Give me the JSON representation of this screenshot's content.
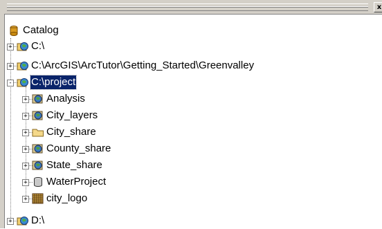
{
  "window": {
    "close_glyph": "x"
  },
  "tree": {
    "root": {
      "label": "Catalog",
      "icon": "catalog-icon"
    },
    "items": [
      {
        "label": "C:\\",
        "icon": "folder-connection-icon",
        "expander": "+"
      },
      {
        "label": "C:\\ArcGIS\\ArcTutor\\Getting_Started\\Greenvalley",
        "icon": "folder-connection-icon",
        "expander": "+"
      },
      {
        "label": "C:\\project",
        "icon": "folder-connection-icon",
        "expander": "-",
        "selected": true,
        "children": [
          {
            "label": "Analysis",
            "icon": "layer-package-icon",
            "expander": "+"
          },
          {
            "label": "City_layers",
            "icon": "layer-package-icon",
            "expander": "+"
          },
          {
            "label": "City_share",
            "icon": "folder-icon",
            "expander": "+"
          },
          {
            "label": "County_share",
            "icon": "layer-package-icon",
            "expander": "+"
          },
          {
            "label": "State_share",
            "icon": "layer-package-icon",
            "expander": "+"
          },
          {
            "label": "WaterProject",
            "icon": "database-icon",
            "expander": "+"
          },
          {
            "label": "city_logo",
            "icon": "raster-icon",
            "expander": "+"
          }
        ]
      },
      {
        "label": "D:\\",
        "icon": "folder-connection-icon",
        "expander": "+"
      }
    ]
  }
}
